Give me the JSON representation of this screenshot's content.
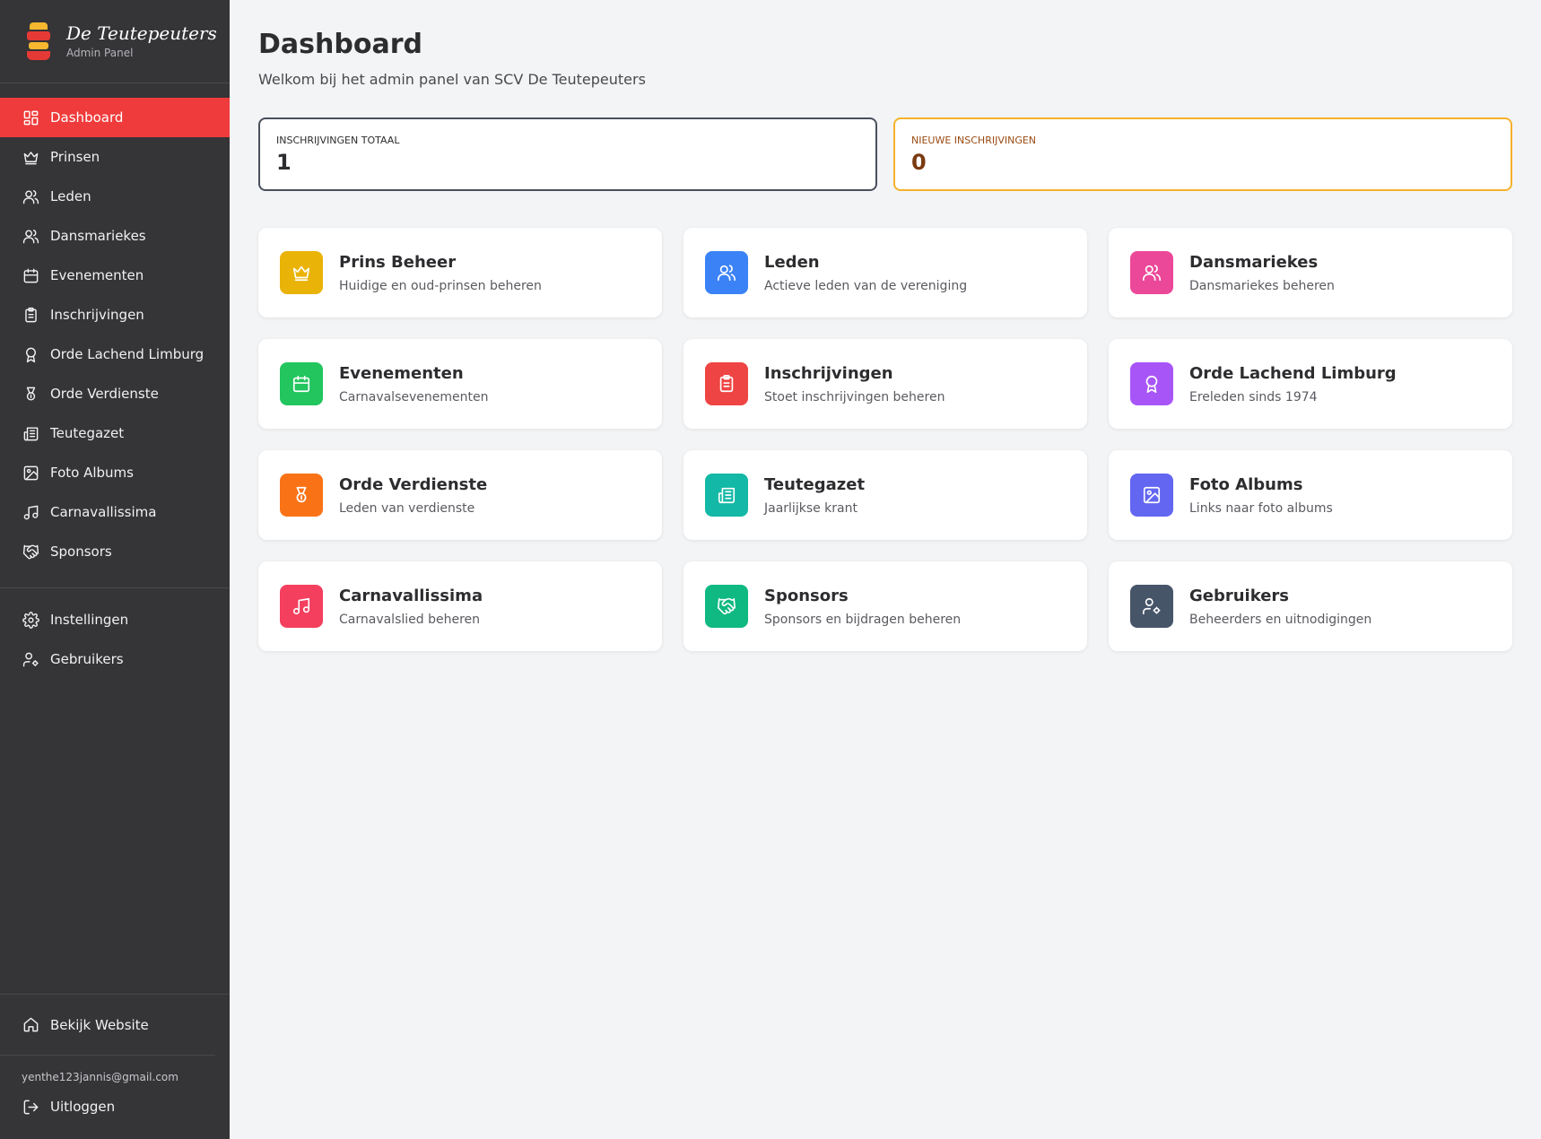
{
  "brand": {
    "title": "De Teutepeuters",
    "subtitle": "Admin Panel"
  },
  "nav": [
    {
      "label": "Dashboard",
      "icon": "dashboard-icon",
      "active": true
    },
    {
      "label": "Prinsen",
      "icon": "crown-icon"
    },
    {
      "label": "Leden",
      "icon": "users-icon"
    },
    {
      "label": "Dansmariekes",
      "icon": "users-icon"
    },
    {
      "label": "Evenementen",
      "icon": "calendar-icon"
    },
    {
      "label": "Inschrijvingen",
      "icon": "clipboard-icon"
    },
    {
      "label": "Orde Lachend Limburg",
      "icon": "award-icon"
    },
    {
      "label": "Orde Verdienste",
      "icon": "medal-icon"
    },
    {
      "label": "Teutegazet",
      "icon": "newspaper-icon"
    },
    {
      "label": "Foto Albums",
      "icon": "image-icon"
    },
    {
      "label": "Carnavallissima",
      "icon": "music-icon"
    },
    {
      "label": "Sponsors",
      "icon": "handshake-icon"
    }
  ],
  "nav_secondary": [
    {
      "label": "Instellingen",
      "icon": "gear-icon"
    },
    {
      "label": "Gebruikers",
      "icon": "user-cog-icon"
    }
  ],
  "sidebar_bottom": {
    "site_link": "Bekijk Website",
    "email": "yenthe123jannis@gmail.com",
    "logout": "Uitloggen"
  },
  "header": {
    "title": "Dashboard",
    "subtitle": "Welkom bij het admin panel van SCV De Teutepeuters"
  },
  "stats": {
    "total_label": "INSCHRIJVINGEN TOTAAL",
    "total_value": "1",
    "new_label": "NIEUWE INSCHRIJVINGEN",
    "new_value": "0"
  },
  "cards": [
    {
      "title": "Prins Beheer",
      "desc": "Huidige en oud-prinsen beheren",
      "icon": "crown-icon",
      "color": "#eab308"
    },
    {
      "title": "Leden",
      "desc": "Actieve leden van de vereniging",
      "icon": "users-icon",
      "color": "#3b82f6"
    },
    {
      "title": "Dansmariekes",
      "desc": "Dansmariekes beheren",
      "icon": "users-icon",
      "color": "#ec4899"
    },
    {
      "title": "Evenementen",
      "desc": "Carnavalsevenementen",
      "icon": "calendar-icon",
      "color": "#22c55e"
    },
    {
      "title": "Inschrijvingen",
      "desc": "Stoet inschrijvingen beheren",
      "icon": "clipboard-icon",
      "color": "#ef4444"
    },
    {
      "title": "Orde Lachend Limburg",
      "desc": "Ereleden sinds 1974",
      "icon": "award-icon",
      "color": "#a855f7"
    },
    {
      "title": "Orde Verdienste",
      "desc": "Leden van verdienste",
      "icon": "medal-icon",
      "color": "#f97316"
    },
    {
      "title": "Teutegazet",
      "desc": "Jaarlijkse krant",
      "icon": "newspaper-icon",
      "color": "#14b8a6"
    },
    {
      "title": "Foto Albums",
      "desc": "Links naar foto albums",
      "icon": "image-icon",
      "color": "#6366f1"
    },
    {
      "title": "Carnavallissima",
      "desc": "Carnavalslied beheren",
      "icon": "music-icon",
      "color": "#f43f5e"
    },
    {
      "title": "Sponsors",
      "desc": "Sponsors en bijdragen beheren",
      "icon": "handshake-icon",
      "color": "#10b981"
    },
    {
      "title": "Gebruikers",
      "desc": "Beheerders en uitnodigingen",
      "icon": "user-cog-icon",
      "color": "#475569"
    }
  ]
}
